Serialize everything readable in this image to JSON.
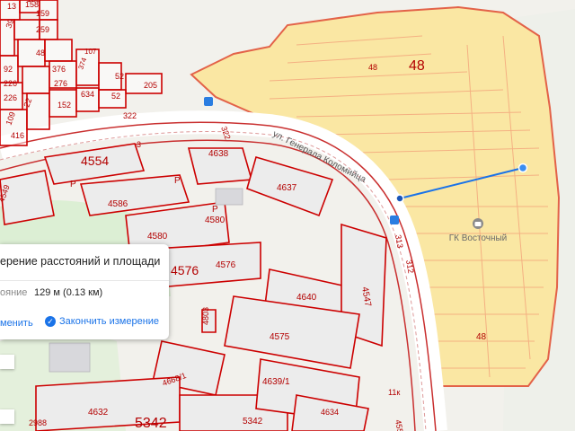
{
  "map": {
    "poi_name": "ГК Восточный",
    "street_name": "ул. Генерала Коломийца",
    "plot_labels": [
      {
        "text": "158"
      },
      {
        "text": "13"
      },
      {
        "text": "159"
      },
      {
        "text": "39"
      },
      {
        "text": "259"
      },
      {
        "text": "48"
      },
      {
        "text": "150"
      },
      {
        "text": "92"
      },
      {
        "text": "376"
      },
      {
        "text": "107"
      },
      {
        "text": "226"
      },
      {
        "text": "276"
      },
      {
        "text": "374"
      },
      {
        "text": "52"
      },
      {
        "text": "205"
      },
      {
        "text": "52"
      },
      {
        "text": "634"
      },
      {
        "text": "152"
      },
      {
        "text": "109"
      },
      {
        "text": "22"
      },
      {
        "text": "226"
      },
      {
        "text": "416"
      },
      {
        "text": "322"
      },
      {
        "text": "322"
      },
      {
        "text": "4554"
      },
      {
        "text": "4638"
      },
      {
        "text": "4637"
      },
      {
        "text": "4549"
      },
      {
        "text": "4586"
      },
      {
        "text": "4580"
      },
      {
        "text": "4580"
      },
      {
        "text": "4576"
      },
      {
        "text": "4576"
      },
      {
        "text": "4640"
      },
      {
        "text": "4547"
      },
      {
        "text": "4575"
      },
      {
        "text": "4803"
      },
      {
        "text": "4668/1"
      },
      {
        "text": "4639/1"
      },
      {
        "text": "4632"
      },
      {
        "text": "2988"
      },
      {
        "text": "5342"
      },
      {
        "text": "5342"
      },
      {
        "text": "4634"
      },
      {
        "text": "4552"
      },
      {
        "text": "313"
      },
      {
        "text": "312"
      },
      {
        "text": "48"
      },
      {
        "text": "48"
      },
      {
        "text": "48"
      },
      {
        "text": "3"
      },
      {
        "text": "3"
      },
      {
        "text": "P"
      },
      {
        "text": "P"
      },
      {
        "text": "P"
      },
      {
        "text": "11к"
      }
    ]
  },
  "measure_panel": {
    "title": "ерение расстояний и площади",
    "distance_label": "ояние",
    "distance_value": "129 м (0.13 км)",
    "edit_link": "менить",
    "finish_label": "Закончить измерение"
  },
  "icons": {
    "finish": "check-circle-icon",
    "poi": "parking-garage-icon",
    "bus": "bus-stop-icon"
  }
}
